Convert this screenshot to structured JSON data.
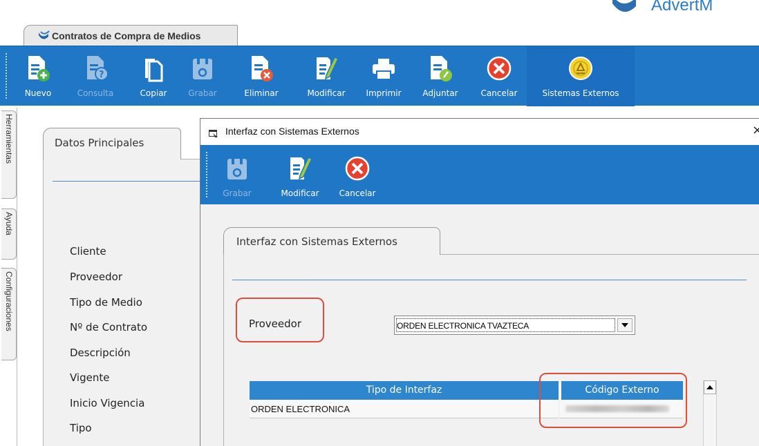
{
  "brand": {
    "text": "AdvertM",
    "color": "#2e7cc3"
  },
  "document_tab": {
    "title": "Contratos de Compra de Medios",
    "icon": "brand-logo-icon"
  },
  "toolbar": {
    "buttons": [
      {
        "label": "Nuevo",
        "icon": "new-document-icon",
        "enabled": true
      },
      {
        "label": "Consulta",
        "icon": "query-document-icon",
        "enabled": false
      },
      {
        "label": "Copiar",
        "icon": "copy-icon",
        "enabled": true
      },
      {
        "label": "Grabar",
        "icon": "save-icon",
        "enabled": false
      },
      {
        "label": "Eliminar",
        "icon": "delete-document-icon",
        "enabled": true
      },
      {
        "label": "Modificar",
        "icon": "edit-document-icon",
        "enabled": true
      },
      {
        "label": "Imprimir",
        "icon": "print-icon",
        "enabled": true
      },
      {
        "label": "Adjuntar",
        "icon": "attach-icon",
        "enabled": true
      },
      {
        "label": "Cancelar",
        "icon": "cancel-icon",
        "enabled": true
      },
      {
        "label": "Sistemas Externos",
        "icon": "external-systems-icon",
        "enabled": true,
        "active": true
      }
    ],
    "bg_color": "#2077c5"
  },
  "side_tabs": [
    "Herramientas",
    "Ayuda",
    "Configuraciones"
  ],
  "main_form": {
    "tab_label": "Datos Principales",
    "fields": [
      "Cliente",
      "Proveedor",
      "Tipo de Medio",
      "Nº de Contrato",
      "Descripción",
      "Vigente",
      "Inicio Vigencia",
      "Tipo"
    ]
  },
  "dialog": {
    "title": "Interfaz con Sistemas Externos",
    "close_glyph": "×",
    "toolbar": [
      {
        "label": "Grabar",
        "icon": "save-icon",
        "enabled": false
      },
      {
        "label": "Modificar",
        "icon": "edit-document-icon",
        "enabled": true
      },
      {
        "label": "Cancelar",
        "icon": "cancel-icon",
        "enabled": true
      }
    ],
    "tab_label": "Interfaz con Sistemas Externos",
    "proveedor_label": "Proveedor",
    "proveedor_value": "ORDEN ELECTRONICA TVAZTECA",
    "grid": {
      "columns": [
        "Tipo de Interfaz",
        "Código Externo"
      ],
      "rows": [
        {
          "tipo": "ORDEN ELECTRONICA",
          "codigo_blurred": true
        }
      ]
    },
    "highlight_color": "#df4d3f"
  }
}
